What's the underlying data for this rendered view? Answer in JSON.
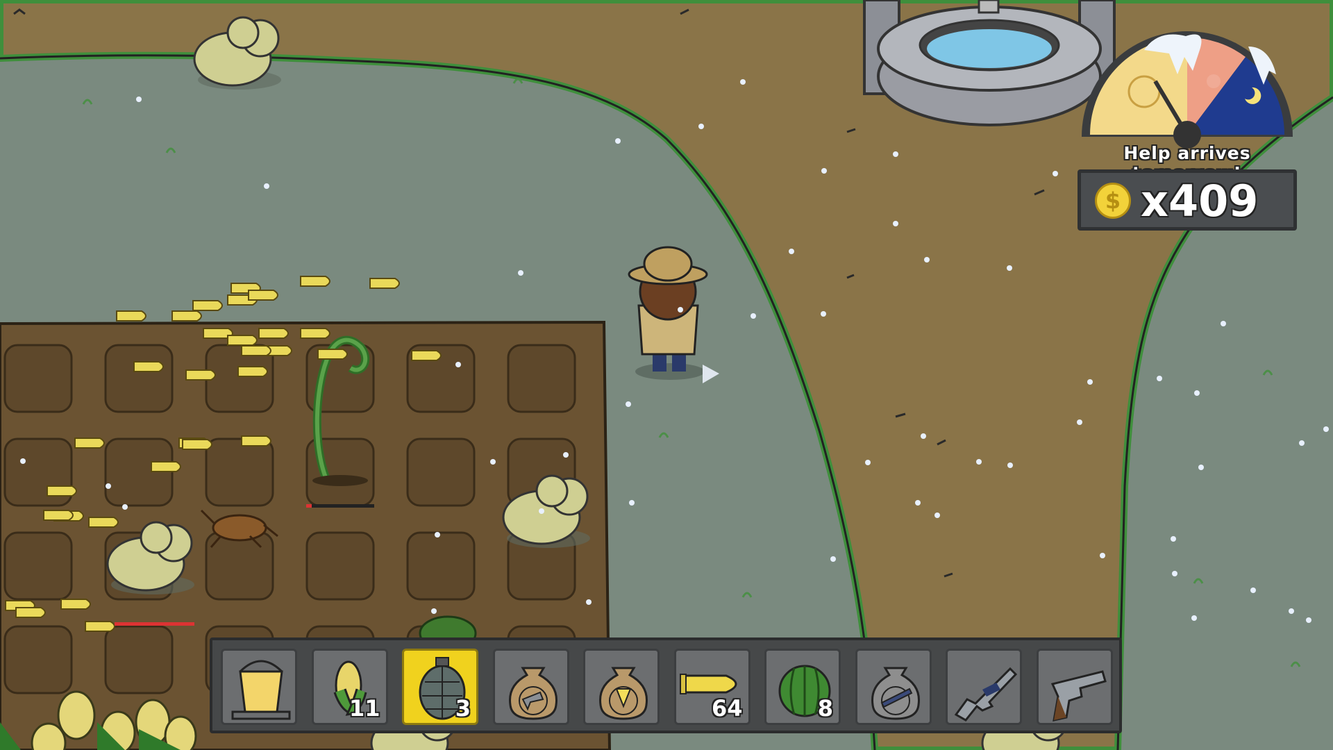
{
  "hud": {
    "message": "Help arrives tomorrow!",
    "money": "x409",
    "coin_symbol": "$",
    "time_of_day": "sun / morning"
  },
  "hotbar": [
    {
      "name": "bucket-slot",
      "icon": "bucket-icon",
      "count": "",
      "selected": false
    },
    {
      "name": "corn-slot",
      "icon": "corn-icon",
      "count": "11",
      "selected": false
    },
    {
      "name": "grenade-slot",
      "icon": "grenade-icon",
      "count": "3",
      "selected": true
    },
    {
      "name": "revolver-seed-bag-slot",
      "icon": "revolver-seed-bag-icon",
      "count": "",
      "selected": false
    },
    {
      "name": "corn-seed-bag-slot",
      "icon": "corn-seed-bag-icon",
      "count": "",
      "selected": false
    },
    {
      "name": "ammo-slot",
      "icon": "bullet-icon",
      "count": "64",
      "selected": false
    },
    {
      "name": "watermelon-slot",
      "icon": "watermelon-icon",
      "count": "8",
      "selected": false
    },
    {
      "name": "rifle-seed-bag-slot",
      "icon": "rifle-seed-bag-icon",
      "count": "",
      "selected": false
    },
    {
      "name": "assault-rifle-slot",
      "icon": "assault-rifle-icon",
      "count": "",
      "selected": false
    },
    {
      "name": "revolver-slot",
      "icon": "revolver-icon",
      "count": "",
      "selected": false
    }
  ],
  "colors": {
    "grass": "#7a8a7f",
    "dirt_path": "#8a7448",
    "field": "#6b5332",
    "grass_edge": "#3f8f3c",
    "selected_slot": "#f0d21e",
    "coin": "#f2d23a"
  }
}
